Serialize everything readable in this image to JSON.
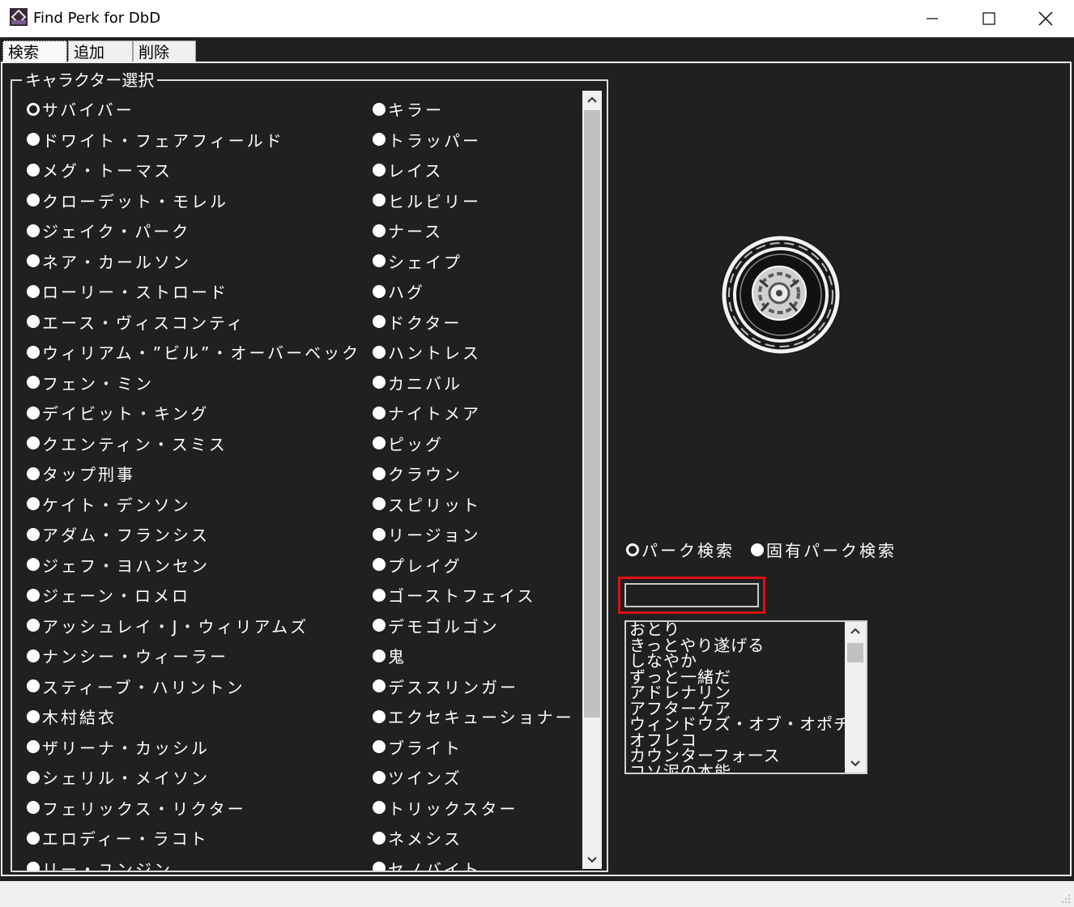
{
  "window": {
    "title": "Find Perk for DbD"
  },
  "tabs": [
    {
      "label": "検索",
      "active": true
    },
    {
      "label": "追加",
      "active": false
    },
    {
      "label": "削除",
      "active": false
    }
  ],
  "character_group": {
    "legend": "キャラクター選択",
    "survivors": [
      "サバイバー",
      "ドワイト・フェアフィールド",
      "メグ・トーマス",
      "クローデット・モレル",
      "ジェイク・パーク",
      "ネア・カールソン",
      "ローリー・ストロード",
      "エース・ヴィスコンティ",
      "ウィリアム・”ビル”・オーバーベック",
      "フェン・ミン",
      "デイビット・キング",
      "クエンティン・スミス",
      "タップ刑事",
      "ケイト・デンソン",
      "アダム・フランシス",
      "ジェフ・ヨハンセン",
      "ジェーン・ロメロ",
      "アッシュレイ・J・ウィリアムズ",
      "ナンシー・ウィーラー",
      "スティーブ・ハリントン",
      "木村結衣",
      "ザリーナ・カッシル",
      "シェリル・メイソン",
      "フェリックス・リクター",
      "エロディー・ラコト",
      "リー・ユンジン"
    ],
    "killers": [
      "キラー",
      "トラッパー",
      "レイス",
      "ヒルビリー",
      "ナース",
      "シェイプ",
      "ハグ",
      "ドクター",
      "ハントレス",
      "カニバル",
      "ナイトメア",
      "ピッグ",
      "クラウン",
      "スピリット",
      "リージョン",
      "プレイグ",
      "ゴーストフェイス",
      "デモゴルゴン",
      "鬼",
      "デススリンガー",
      "エクセキューショナー",
      "ブライト",
      "ツインズ",
      "トリックスター",
      "ネメシス",
      "セノバイト"
    ],
    "selected": "サバイバー"
  },
  "search_mode": {
    "options": [
      "パーク検索",
      "固有パーク検索"
    ],
    "selected": "パーク検索"
  },
  "search": {
    "value": "",
    "placeholder": ""
  },
  "perk_list": [
    "おとり",
    "きっとやり遂げる",
    "しなやか",
    "ずっと一緒だ",
    "アドレナリン",
    "アフターケア",
    "ウィンドウズ・オブ・オポチュニティ",
    "オフレコ",
    "カウンターフォース",
    "コソ泥の本能"
  ],
  "perk_icon": {
    "name": "perk-emblem-icon"
  },
  "colors": {
    "background": "#202020",
    "foreground": "#ffffff",
    "highlight": "#e01010",
    "titlebar": "#ffffff"
  }
}
